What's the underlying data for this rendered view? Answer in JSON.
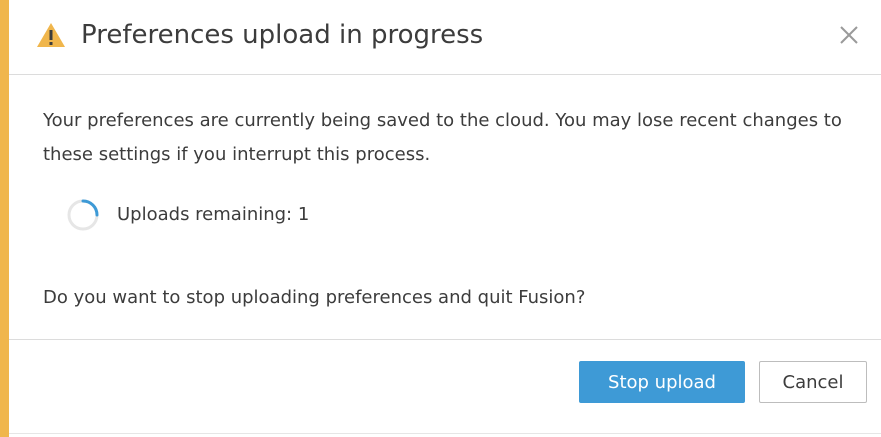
{
  "dialog": {
    "title": "Preferences upload in progress",
    "message": "Your preferences are currently being saved to the cloud. You may lose recent changes to these settings if you interrupt this process.",
    "status": "Uploads remaining: 1",
    "question": "Do you want to stop uploading preferences and quit Fusion?",
    "buttons": {
      "primary_label": "Stop upload",
      "secondary_label": "Cancel"
    },
    "icons": {
      "title_icon": "warning-icon",
      "close_icon": "close-icon",
      "status_icon": "spinner-icon"
    },
    "colors": {
      "accent": "#f0b64c",
      "primary_button": "#3e9ad6",
      "spinner": "#3e9ad6"
    }
  }
}
